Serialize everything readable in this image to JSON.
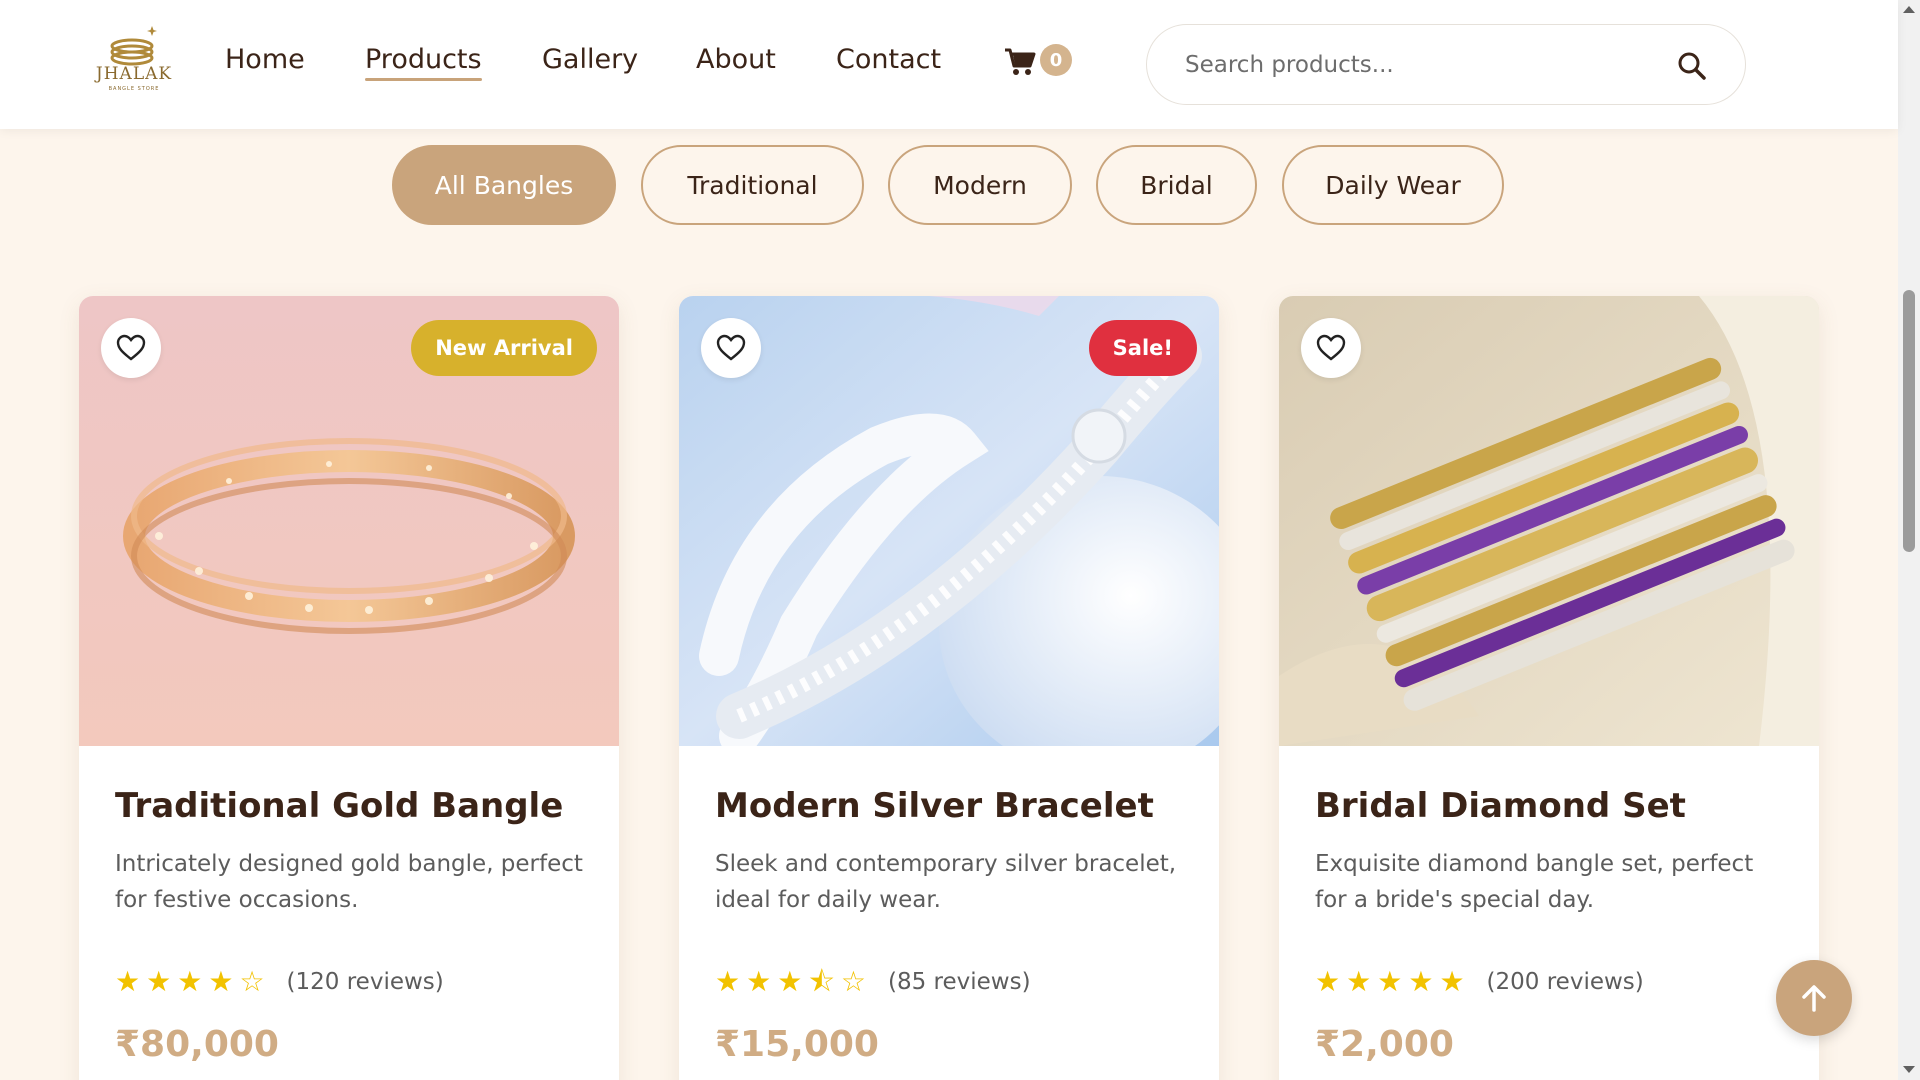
{
  "brand": {
    "name": "JHALAK",
    "tagline": "BANGLE STORE"
  },
  "nav": {
    "items": [
      {
        "label": "Home",
        "active": false
      },
      {
        "label": "Products",
        "active": true
      },
      {
        "label": "Gallery",
        "active": false
      },
      {
        "label": "About",
        "active": false
      },
      {
        "label": "Contact",
        "active": false
      }
    ],
    "cart_count": "0",
    "cart_icon": "shopping-cart-icon"
  },
  "search": {
    "placeholder": "Search products...",
    "value": "",
    "icon": "search-icon"
  },
  "filters": [
    {
      "label": "All Bangles",
      "active": true
    },
    {
      "label": "Traditional",
      "active": false
    },
    {
      "label": "Modern",
      "active": false
    },
    {
      "label": "Bridal",
      "active": false
    },
    {
      "label": "Daily Wear",
      "active": false
    }
  ],
  "products": [
    {
      "title": "Traditional Gold Bangle",
      "description": "Intricately designed gold bangle, perfect for festive occasions.",
      "rating": 4,
      "stars": "★★★★☆",
      "reviews": "(120 reviews)",
      "price": "₹80,000",
      "badge": "New Arrival",
      "badge_color": "#d7b12c"
    },
    {
      "title": "Modern Silver Bracelet",
      "description": "Sleek and contemporary silver bracelet, ideal for daily wear.",
      "rating": 3.5,
      "stars": "★★★⯪☆",
      "reviews": "(85 reviews)",
      "price": "₹15,000",
      "badge": "Sale!",
      "badge_color": "#e0303f"
    },
    {
      "title": "Bridal Diamond Set",
      "description": "Exquisite diamond bangle set, perfect for a bride's special day.",
      "rating": 5,
      "stars": "★★★★★",
      "reviews": "(200 reviews)",
      "price": "₹2,000",
      "badge": "",
      "badge_color": ""
    }
  ],
  "colors": {
    "accent": "#c9a47c",
    "page_bg": "#fdf5ec",
    "text_dark": "#3b2418",
    "star": "#f2c200",
    "price": "#d0ac84"
  }
}
